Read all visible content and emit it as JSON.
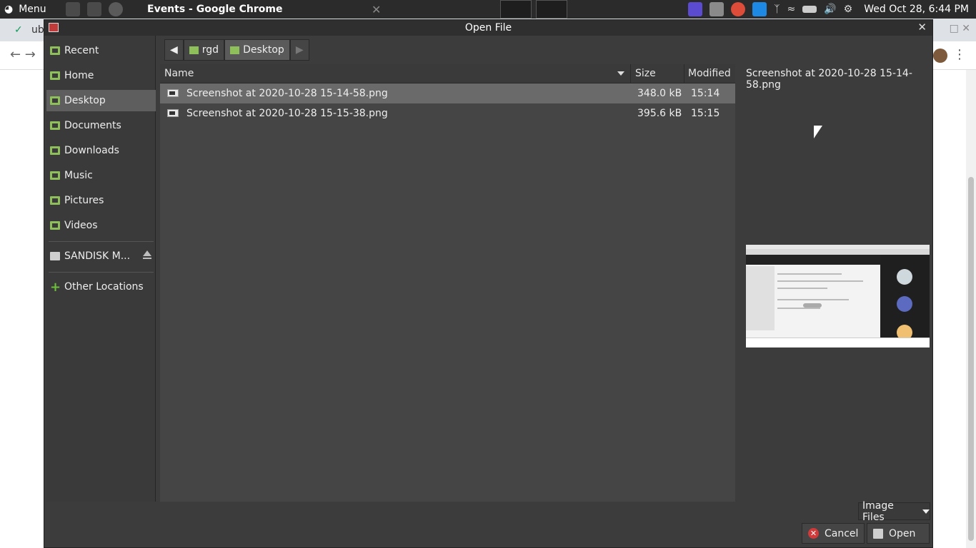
{
  "panel": {
    "menu_label": "Menu",
    "window_title": "Events - Google Chrome",
    "clock": "Wed Oct 28,  6:44 PM"
  },
  "browser": {
    "tab_text": "ub"
  },
  "dialog": {
    "title": "Open File",
    "places": [
      {
        "label": "Recent"
      },
      {
        "label": "Home"
      },
      {
        "label": "Desktop"
      },
      {
        "label": "Documents"
      },
      {
        "label": "Downloads"
      },
      {
        "label": "Music"
      },
      {
        "label": "Pictures"
      },
      {
        "label": "Videos"
      },
      {
        "label": "SANDISK M..."
      },
      {
        "label": "Other Locations"
      }
    ],
    "pathbar": {
      "segments": [
        "rgd",
        "Desktop"
      ]
    },
    "columns": {
      "name": "Name",
      "size": "Size",
      "modified": "Modified"
    },
    "files": [
      {
        "name": "Screenshot at 2020-10-28 15-14-58.png",
        "size": "348.0 kB",
        "modified": "15:14"
      },
      {
        "name": "Screenshot at 2020-10-28 15-15-38.png",
        "size": "395.6 kB",
        "modified": "15:15"
      }
    ],
    "preview": {
      "filename": "Screenshot at 2020-10-28 15-14-58.png"
    },
    "filter": "Image Files",
    "cancel_label": "Cancel",
    "open_label": "Open"
  }
}
